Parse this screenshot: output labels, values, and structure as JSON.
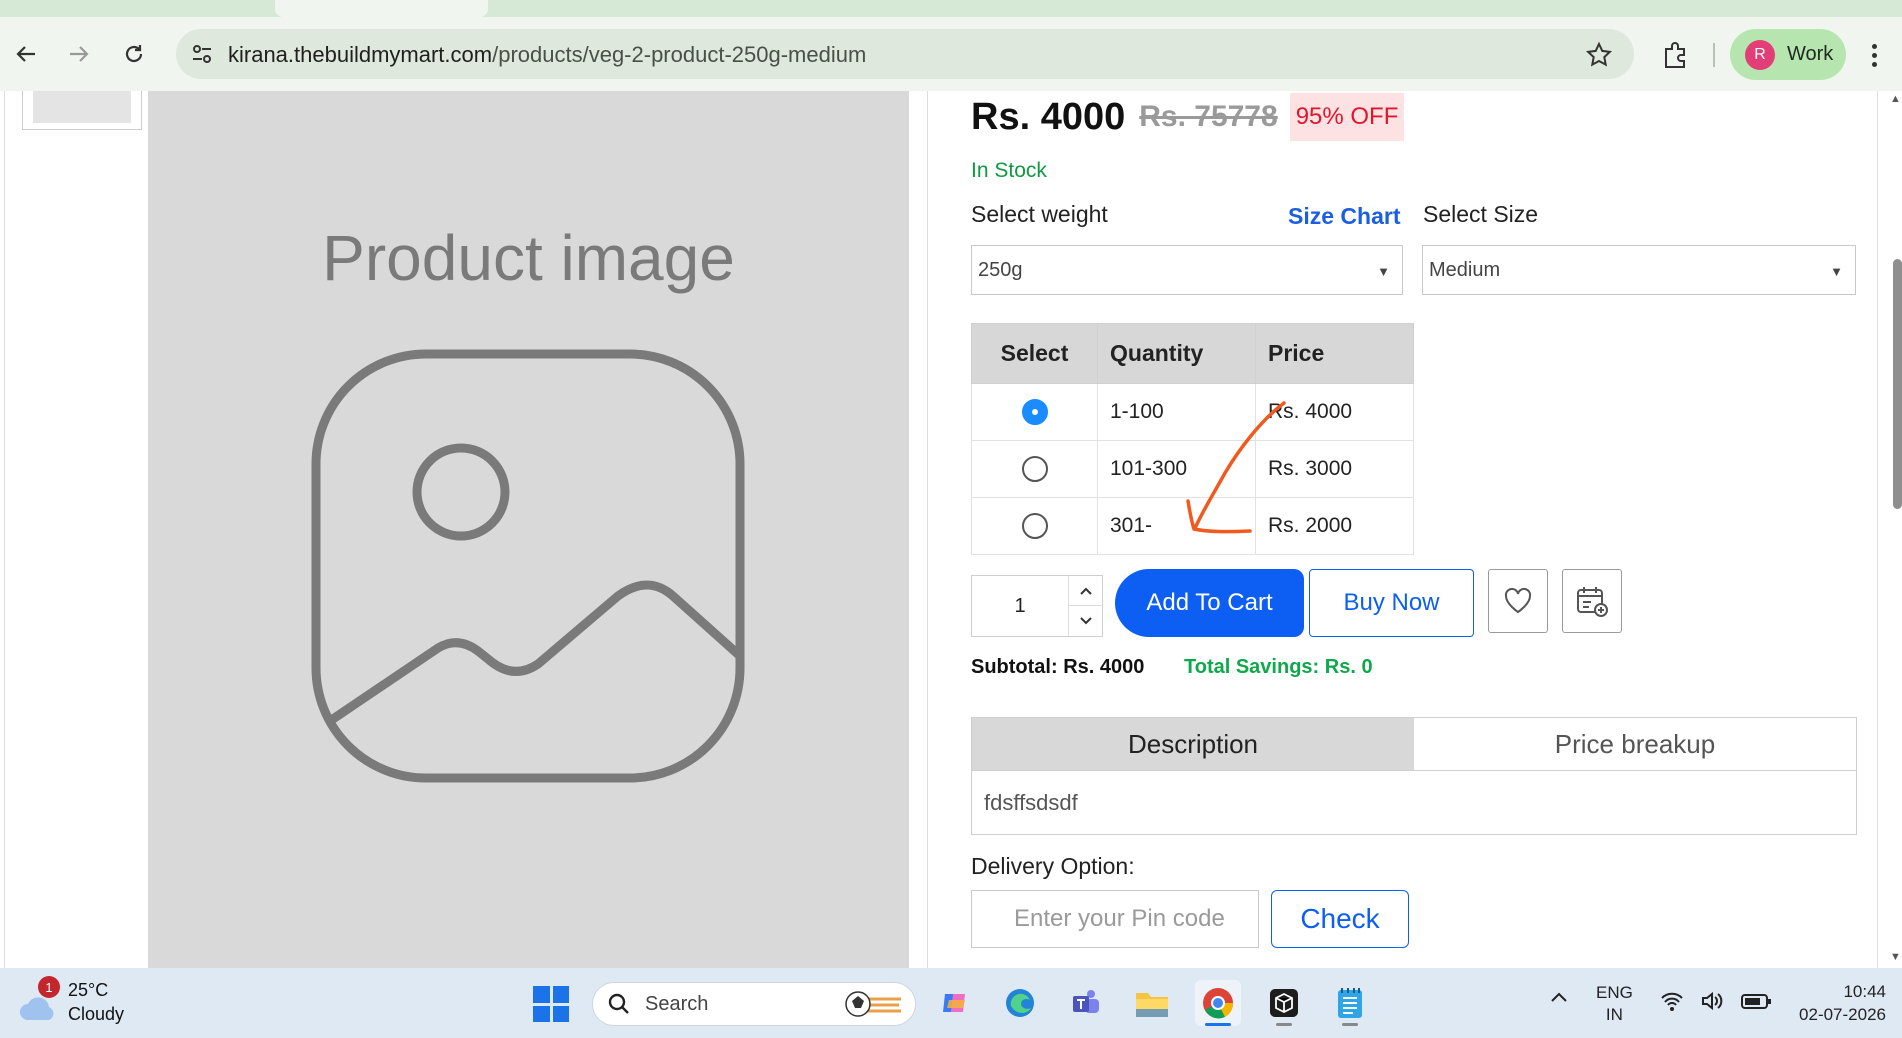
{
  "browser": {
    "url_host": "kirana.thebuildmymart.com",
    "url_path": "/products/veg-2-product-250g-medium",
    "profile_initial": "R",
    "profile_label": "Work"
  },
  "product": {
    "image_placeholder": "Product image",
    "price": "Rs. 4000",
    "mrp": "Rs. 75778",
    "discount": "95% OFF",
    "stock": "In Stock",
    "weight_label": "Select weight",
    "size_chart": "Size Chart",
    "size_label": "Select Size",
    "weight_value": "250g",
    "size_value": "Medium",
    "table": {
      "headers": [
        "Select",
        "Quantity",
        "Price"
      ],
      "rows": [
        {
          "quantity": "1-100",
          "price": "Rs. 4000",
          "selected": true
        },
        {
          "quantity": "101-300",
          "price": "Rs. 3000",
          "selected": false
        },
        {
          "quantity": "301-",
          "price": "Rs. 2000",
          "selected": false
        }
      ]
    },
    "qty": "1",
    "add_to_cart": "Add To Cart",
    "buy_now": "Buy Now",
    "subtotal": "Subtotal: Rs. 4000",
    "savings": "Total Savings: Rs. 0",
    "tabs": [
      "Description",
      "Price breakup"
    ],
    "description": "fdsffsdsdf",
    "delivery_label": "Delivery Option:",
    "pin_placeholder": "Enter your Pin code",
    "check": "Check"
  },
  "taskbar": {
    "weather_badge": "1",
    "weather_temp": "25°C",
    "weather_desc": "Cloudy",
    "search": "Search",
    "lang_1": "ENG",
    "lang_2": "IN",
    "time": "10:44",
    "date": "02-07-2026"
  },
  "colors": {
    "accent": "#0c5ff2",
    "success": "#0e9a40",
    "danger": "#e0162b",
    "annotation": "#f05a1e"
  }
}
